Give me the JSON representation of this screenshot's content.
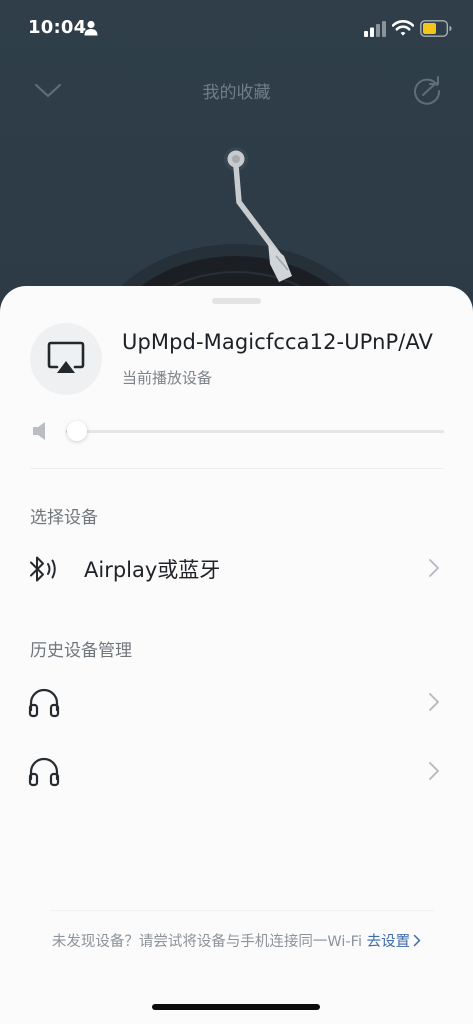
{
  "status_bar": {
    "time": "10:04",
    "icons": [
      "person-icon",
      "signal-icon",
      "wifi-icon",
      "battery-icon"
    ],
    "battery_color": "#f5c518"
  },
  "player": {
    "title": "我的收藏",
    "icons": [
      "chevron-down-icon",
      "share-icon"
    ]
  },
  "sheet": {
    "current_device": {
      "name": "UpMpd-Magicfcca12-UPnP/AV",
      "status": "当前播放设备",
      "icon": "airplay-icon"
    },
    "volume": {
      "level": 0.03,
      "icon": "speaker-icon"
    },
    "select_section": {
      "label": "选择设备",
      "items": [
        {
          "label": "Airplay或蓝牙",
          "icon": "bluetooth-audio-icon"
        }
      ]
    },
    "history_section": {
      "label": "历史设备管理",
      "items": [
        {
          "label": "",
          "icon": "headphones-icon"
        },
        {
          "label": "",
          "icon": "headphones-icon"
        }
      ]
    },
    "footer": {
      "text": "未发现设备？请尝试将设备与手机连接同一Wi-Fi",
      "link": "去设置"
    }
  },
  "colors": {
    "background": "#2f3e49",
    "sheet": "#fbfbfc",
    "link": "#3c6aa8"
  }
}
